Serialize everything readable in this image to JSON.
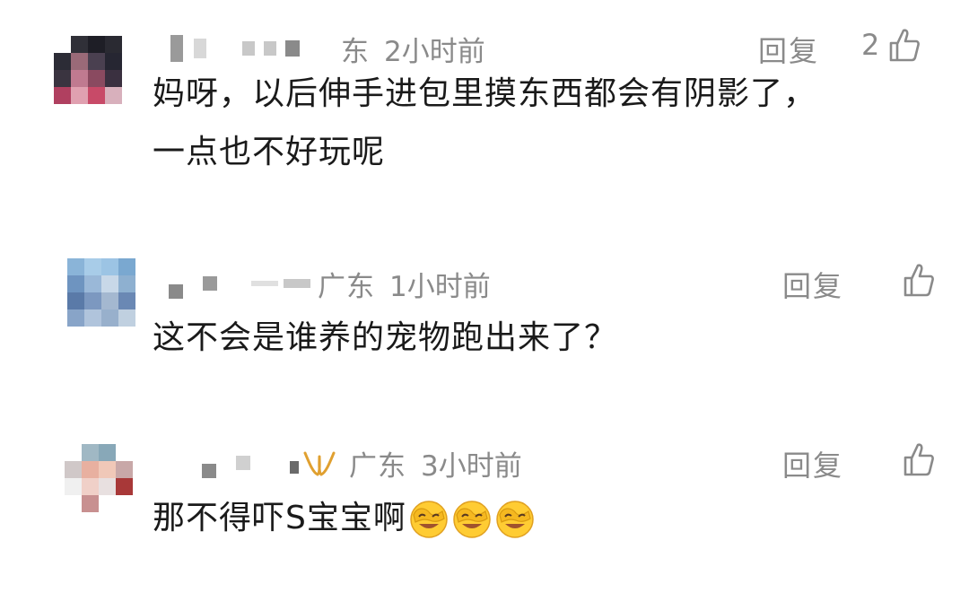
{
  "comments": [
    {
      "region": "东",
      "time": "2小时前",
      "reply": "回复",
      "likes": "2",
      "lines": [
        "妈呀，以后伸手进包里摸东西都会有阴影了，",
        "一点也不好玩呢"
      ],
      "icons": [
        "thumbs-up-icon"
      ]
    },
    {
      "region": "广东",
      "time": "1小时前",
      "reply": "回复",
      "likes": "",
      "lines": [
        "这不会是谁养的宠物跑出来了？"
      ],
      "icons": [
        "thumbs-up-icon"
      ]
    },
    {
      "region": "广东",
      "time": "3小时前",
      "reply": "回复",
      "likes": "",
      "lines": [
        "那不得吓S宝宝啊"
      ],
      "icons": [
        "thumbs-up-icon",
        "facepalm-emoji",
        "facepalm-emoji",
        "facepalm-emoji"
      ]
    }
  ]
}
